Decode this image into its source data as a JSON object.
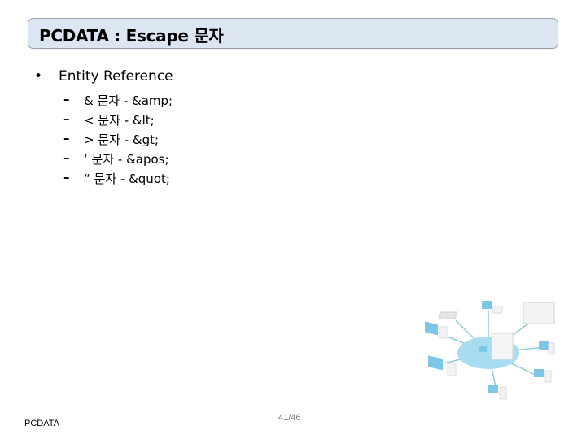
{
  "slide": {
    "title": "PCDATA : Escape 문자",
    "bullet": {
      "marker": "•",
      "text": "Entity Reference"
    },
    "sub_items": [
      {
        "marker": "–",
        "text": "& 문자 - &amp;"
      },
      {
        "marker": "–",
        "text": "< 문자 - &lt;"
      },
      {
        "marker": "–",
        "text": "> 문자 - &gt;"
      },
      {
        "marker": "–",
        "text": "‘ 문자 - &apos;"
      },
      {
        "marker": "–",
        "text": "“ 문자 - &quot;"
      }
    ],
    "image": {
      "icon": "network-diagram-icon"
    },
    "footer": {
      "left": "PCDATA",
      "page": "41/46"
    },
    "colors": {
      "title_bg": "#dce6f2",
      "title_border": "#9aa3ad",
      "page_number": "#7f7f7f",
      "network_hub": "#a8dcf0"
    }
  }
}
